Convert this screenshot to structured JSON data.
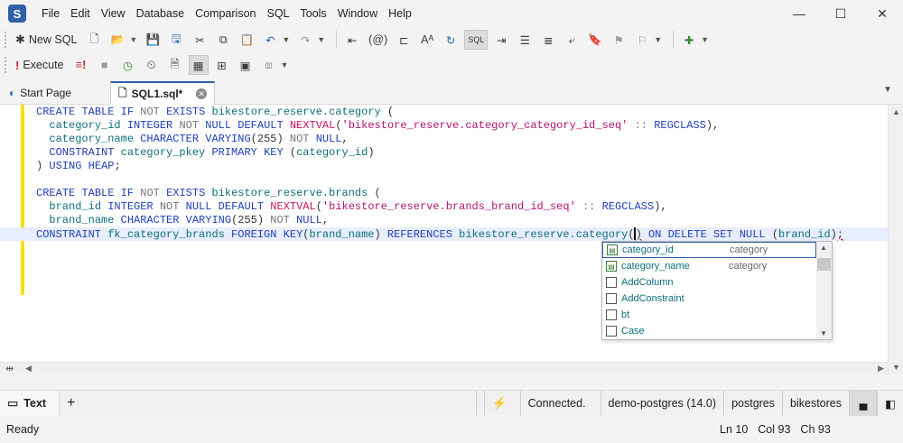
{
  "app": {
    "logo": "S"
  },
  "menu": [
    "File",
    "Edit",
    "View",
    "Database",
    "Comparison",
    "SQL",
    "Tools",
    "Window",
    "Help"
  ],
  "window_controls": {
    "minimize": "—",
    "maximize": "☐",
    "close": "✕"
  },
  "toolbar1": {
    "new_sql": "New SQL"
  },
  "toolbar2": {
    "execute": "Execute"
  },
  "tabs": [
    {
      "label": "Start Page"
    },
    {
      "label": "SQL1.sql*"
    }
  ],
  "editor": {
    "lines": [
      "CREATE TABLE IF NOT EXISTS bikestore_reserve.category (",
      "  category_id INTEGER NOT NULL DEFAULT NEXTVAL('bikestore_reserve.category_category_id_seq' :: REGCLASS),",
      "  category_name CHARACTER VARYING(255) NOT NULL,",
      "  CONSTRAINT category_pkey PRIMARY KEY (category_id)",
      ") USING HEAP;",
      "",
      "CREATE TABLE IF NOT EXISTS bikestore_reserve.brands (",
      "  brand_id INTEGER NOT NULL DEFAULT NEXTVAL('bikestore_reserve.brands_brand_id_seq' :: REGCLASS),",
      "  brand_name CHARACTER VARYING(255) NOT NULL,",
      "CONSTRAINT fk_category_brands FOREIGN KEY(brand_name) REFERENCES bikestore_reserve.category() ON DELETE SET NULL (brand_id);"
    ]
  },
  "autocomplete": {
    "items": [
      {
        "name": "category_id",
        "source": "category",
        "kind": "column",
        "selected": true
      },
      {
        "name": "category_name",
        "source": "category",
        "kind": "column",
        "selected": false
      },
      {
        "name": "AddColumn",
        "source": "",
        "kind": "snippet",
        "selected": false
      },
      {
        "name": "AddConstraint",
        "source": "",
        "kind": "snippet",
        "selected": false
      },
      {
        "name": "bt",
        "source": "",
        "kind": "snippet",
        "selected": false
      },
      {
        "name": "Case",
        "source": "",
        "kind": "snippet",
        "selected": false
      }
    ]
  },
  "bottom": {
    "text_tab": "Text",
    "add": "+",
    "status": "Connected.",
    "connection": "demo-postgres (14.0)",
    "user": "postgres",
    "database": "bikestores"
  },
  "statusbar": {
    "state": "Ready",
    "line": "Ln 10",
    "col": "Col 93",
    "ch": "Ch 93"
  }
}
